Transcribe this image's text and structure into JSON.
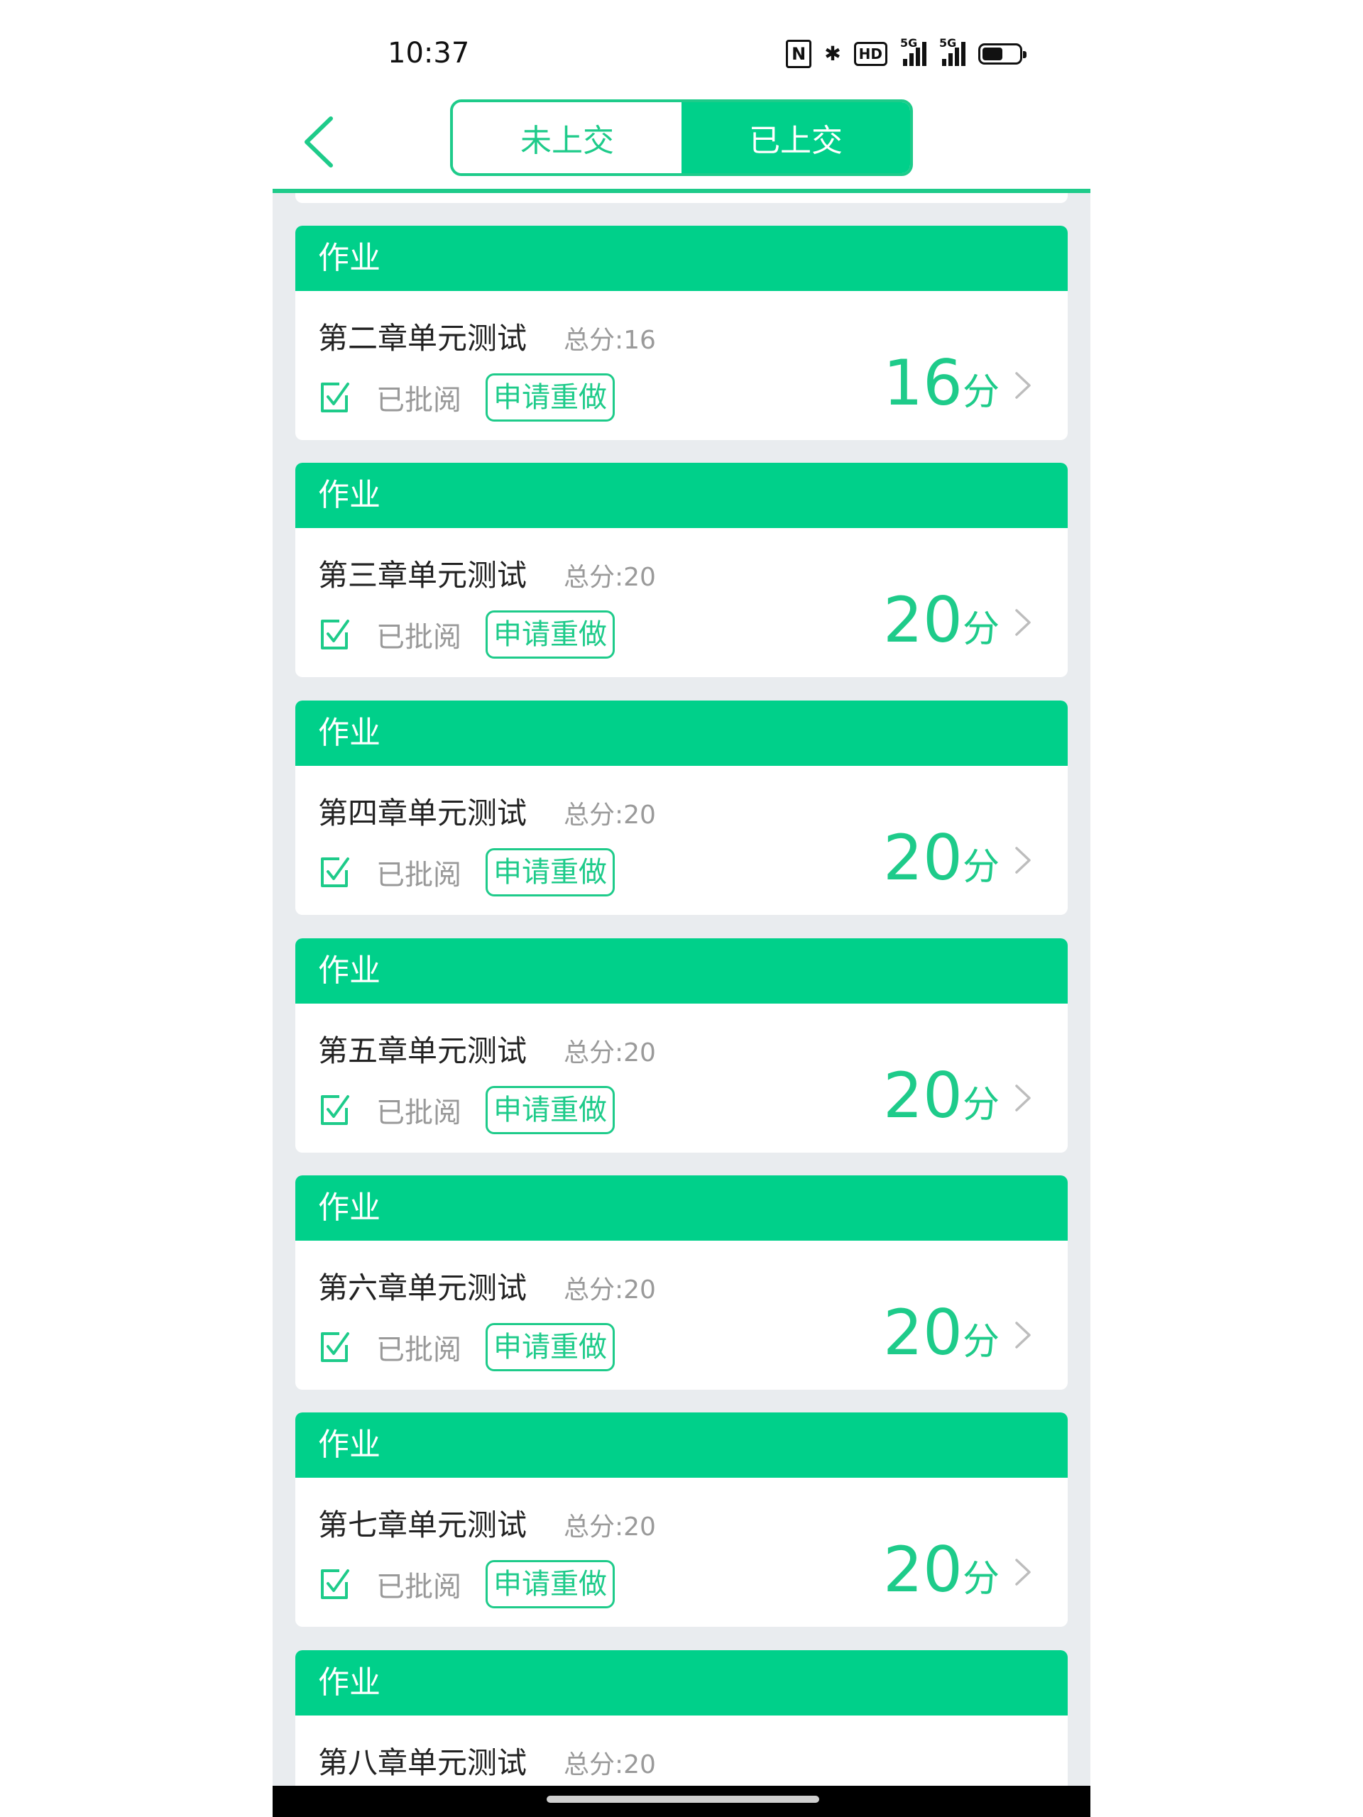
{
  "status_bar": {
    "time": "10:37",
    "icons": [
      "nfc-icon",
      "bluetooth-icon",
      "hd-icon",
      "signal-5g-icon",
      "signal-5g-icon",
      "battery-icon"
    ],
    "nfc": "N",
    "bluetooth": "✱",
    "hd": "HD",
    "signal_1_label": "5G",
    "signal_2_label": "5G",
    "battery_level": 0.55
  },
  "header": {
    "tabs": [
      {
        "label": "未上交",
        "active": false
      },
      {
        "label": "已上交",
        "active": true
      }
    ]
  },
  "colors": {
    "accent": "#00d08a",
    "accent_text": "#1ecb8a",
    "background": "#e9ecef"
  },
  "cards": [
    {
      "type_label": "作业",
      "title": "第二章单元测试",
      "total": "总分:16",
      "status": "已批阅",
      "redo_label": "申请重做",
      "score": "16",
      "unit": "分"
    },
    {
      "type_label": "作业",
      "title": "第三章单元测试",
      "total": "总分:20",
      "status": "已批阅",
      "redo_label": "申请重做",
      "score": "20",
      "unit": "分"
    },
    {
      "type_label": "作业",
      "title": "第四章单元测试",
      "total": "总分:20",
      "status": "已批阅",
      "redo_label": "申请重做",
      "score": "20",
      "unit": "分"
    },
    {
      "type_label": "作业",
      "title": "第五章单元测试",
      "total": "总分:20",
      "status": "已批阅",
      "redo_label": "申请重做",
      "score": "20",
      "unit": "分"
    },
    {
      "type_label": "作业",
      "title": "第六章单元测试",
      "total": "总分:20",
      "status": "已批阅",
      "redo_label": "申请重做",
      "score": "20",
      "unit": "分"
    },
    {
      "type_label": "作业",
      "title": "第七章单元测试",
      "total": "总分:20",
      "status": "已批阅",
      "redo_label": "申请重做",
      "score": "20",
      "unit": "分"
    },
    {
      "type_label": "作业",
      "title": "第八章单元测试",
      "total": "总分:20"
    }
  ]
}
